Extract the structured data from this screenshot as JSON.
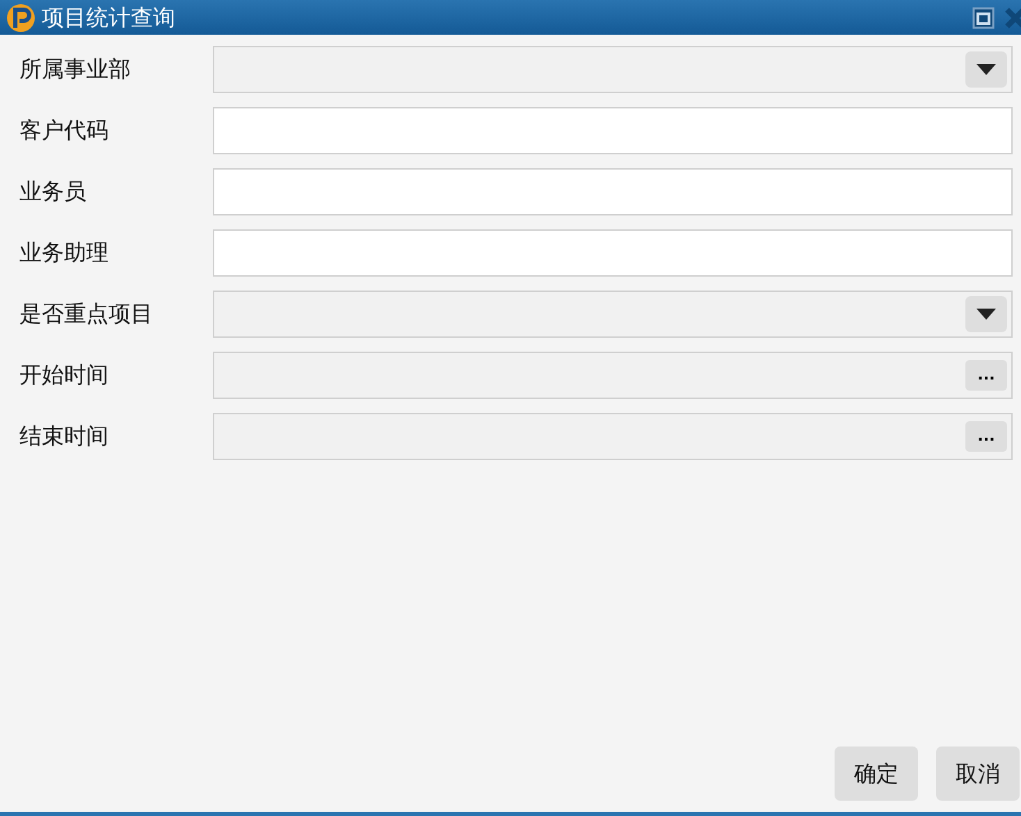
{
  "window": {
    "title": "项目统计查询"
  },
  "fields": [
    {
      "label": "所属事业部",
      "kind": "select"
    },
    {
      "label": "客户代码",
      "kind": "text"
    },
    {
      "label": "业务员",
      "kind": "text"
    },
    {
      "label": "业务助理",
      "kind": "text"
    },
    {
      "label": "是否重点项目",
      "kind": "select"
    },
    {
      "label": "开始时间",
      "kind": "picker",
      "button": "..."
    },
    {
      "label": "结束时间",
      "kind": "picker",
      "button": "..."
    }
  ],
  "buttons": [
    "确定",
    "取消"
  ]
}
